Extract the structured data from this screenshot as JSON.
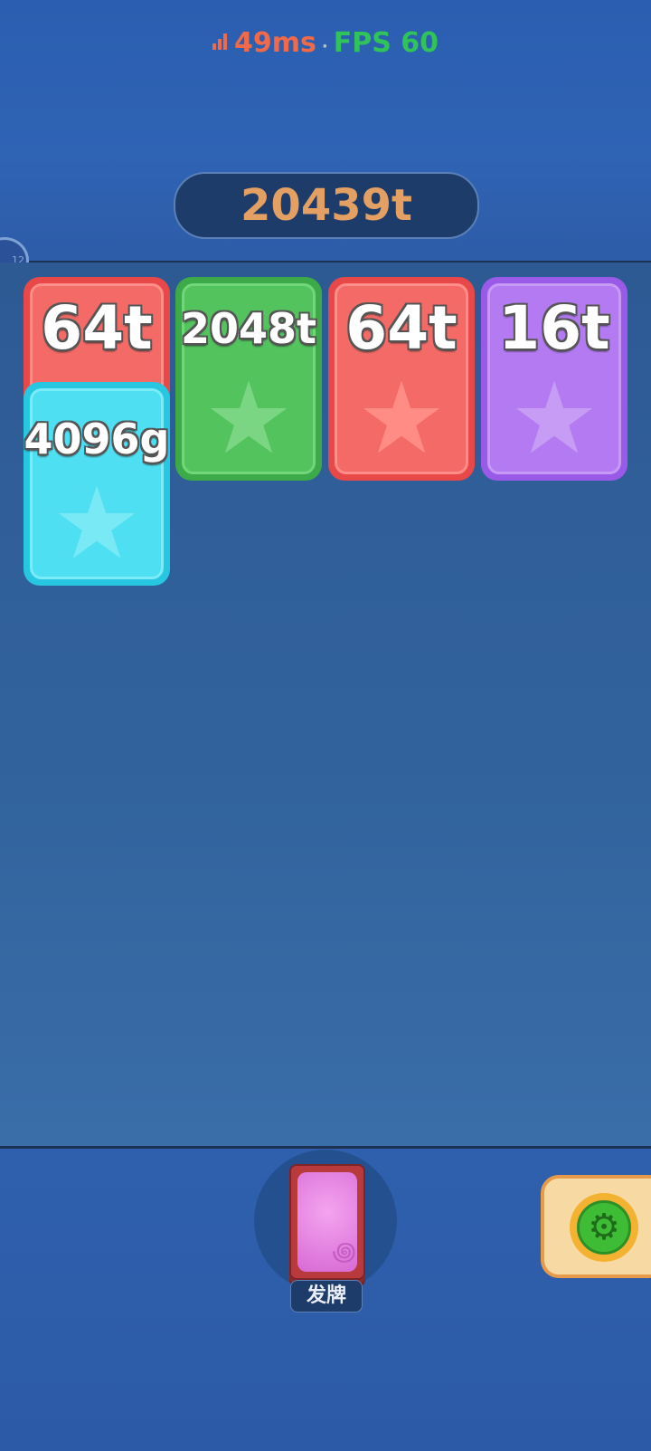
{
  "status": {
    "latency": "49ms",
    "separator": "·",
    "fps": "FPS 60"
  },
  "score": "20439t",
  "side_badge": "12",
  "cards": [
    {
      "value": "64t",
      "color": "red"
    },
    {
      "value": "2048t",
      "color": "green"
    },
    {
      "value": "64t",
      "color": "red"
    },
    {
      "value": "16t",
      "color": "purple"
    },
    {
      "value": "4096g",
      "color": "cyan"
    }
  ],
  "icons": {
    "card_emblem": "star-icon",
    "settings": "gear-icon",
    "signal": "signal-bars-icon"
  },
  "deal_button_label": "发牌"
}
